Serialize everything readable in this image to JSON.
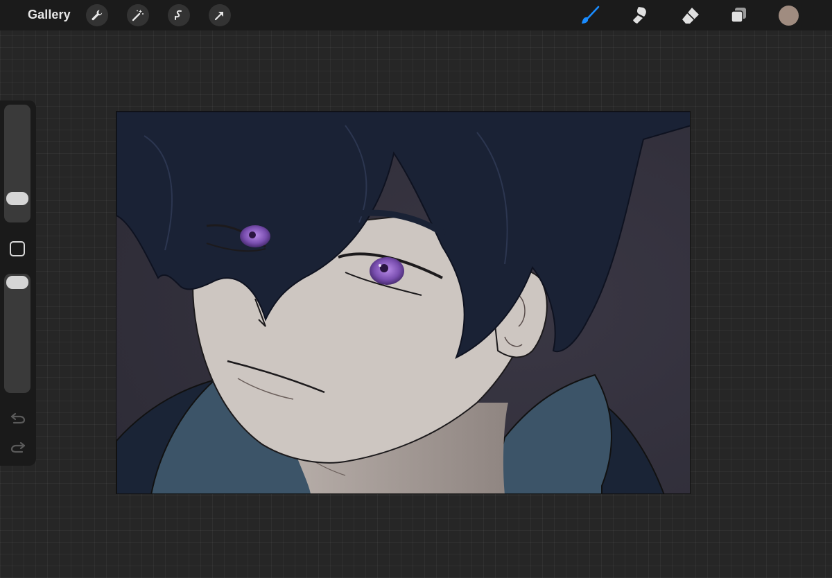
{
  "topbar": {
    "gallery_label": "Gallery",
    "left_tools": [
      "wrench-icon",
      "magic-wand-icon",
      "selection-icon",
      "transform-arrow-icon"
    ],
    "right_tools": [
      "brush-icon",
      "smudge-icon",
      "eraser-icon",
      "layers-icon"
    ],
    "active_tool": "brush",
    "accent_color": "#1a8cff",
    "current_color": "#a08c80"
  },
  "sidebar": {
    "brush_size_level": 0.15,
    "opacity_level": 1.0,
    "icons": [
      "modify-square-icon",
      "undo-icon",
      "redo-icon"
    ]
  },
  "canvas": {
    "artwork": "anime-boy-portrait",
    "colors": {
      "background": "#35323e",
      "hair": "#1a2235",
      "skin": "#cdc6c1",
      "hoodie": "#3c5468",
      "jacket": "#1a2436",
      "iris": "#7a4fb0",
      "line": "#1c1a1c"
    }
  }
}
